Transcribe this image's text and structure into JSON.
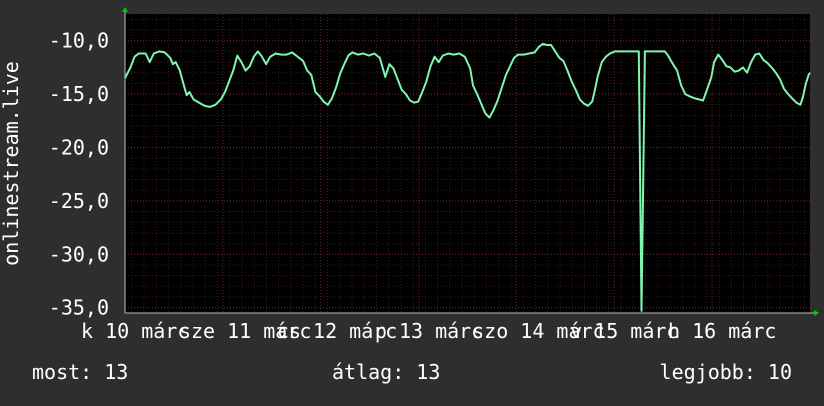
{
  "chart_data": {
    "type": "line",
    "ylabel": "onlinestream.live",
    "ylim": [
      -35.5,
      -7.5
    ],
    "yticks": [
      -10,
      -15,
      -20,
      -25,
      -30,
      -35
    ],
    "ytick_labels": [
      "-10,0",
      "-15,0",
      "-20,0",
      "-25,0",
      "-30,0",
      "-35,0"
    ],
    "xlim": [
      0,
      100
    ],
    "xtick_labels": [
      {
        "x": 0.0,
        "label": "k 10 márc"
      },
      {
        "x": 14.3,
        "label": "sze 11 márc"
      },
      {
        "x": 28.6,
        "label": "cs 12 márc"
      },
      {
        "x": 42.9,
        "label": "p 13 márc"
      },
      {
        "x": 57.1,
        "label": "szo 14 márc"
      },
      {
        "x": 71.4,
        "label": "v 15 márc"
      },
      {
        "x": 85.7,
        "label": "h 16 márc"
      }
    ],
    "grid": true,
    "colors": {
      "background": "#2e2e2e",
      "plot_background": "#000000",
      "line": "#7ff5b0",
      "grid": "#4a2222",
      "text": "#ffffff",
      "arrow": "#00cc00"
    },
    "series": [
      {
        "values": [
          [
            0.0,
            -13.5
          ],
          [
            0.8,
            -12.5
          ],
          [
            1.4,
            -11.5
          ],
          [
            2.0,
            -11.2
          ],
          [
            3.0,
            -11.2
          ],
          [
            3.6,
            -12.0
          ],
          [
            4.2,
            -11.2
          ],
          [
            5.0,
            -11.0
          ],
          [
            5.8,
            -11.1
          ],
          [
            6.6,
            -11.6
          ],
          [
            7.0,
            -12.2
          ],
          [
            7.4,
            -12.0
          ],
          [
            8.0,
            -12.8
          ],
          [
            8.6,
            -14.2
          ],
          [
            9.0,
            -15.1
          ],
          [
            9.4,
            -14.8
          ],
          [
            10.0,
            -15.5
          ],
          [
            10.8,
            -15.8
          ],
          [
            11.6,
            -16.1
          ],
          [
            12.4,
            -16.2
          ],
          [
            13.2,
            -16.0
          ],
          [
            14.0,
            -15.5
          ],
          [
            14.6,
            -14.8
          ],
          [
            15.2,
            -13.8
          ],
          [
            15.8,
            -12.8
          ],
          [
            16.4,
            -11.4
          ],
          [
            17.0,
            -12.0
          ],
          [
            17.6,
            -12.8
          ],
          [
            18.2,
            -12.4
          ],
          [
            18.8,
            -11.5
          ],
          [
            19.4,
            -11.0
          ],
          [
            20.0,
            -11.5
          ],
          [
            20.6,
            -12.2
          ],
          [
            21.2,
            -11.5
          ],
          [
            22.0,
            -11.2
          ],
          [
            22.8,
            -11.3
          ],
          [
            23.6,
            -11.3
          ],
          [
            24.4,
            -11.1
          ],
          [
            25.2,
            -11.5
          ],
          [
            26.0,
            -11.9
          ],
          [
            26.6,
            -12.8
          ],
          [
            27.2,
            -13.2
          ],
          [
            27.8,
            -14.8
          ],
          [
            28.4,
            -15.2
          ],
          [
            29.0,
            -15.7
          ],
          [
            29.6,
            -16.0
          ],
          [
            30.2,
            -15.4
          ],
          [
            30.8,
            -14.4
          ],
          [
            31.4,
            -13.1
          ],
          [
            32.0,
            -12.2
          ],
          [
            32.6,
            -11.4
          ],
          [
            33.2,
            -11.1
          ],
          [
            34.0,
            -11.3
          ],
          [
            34.8,
            -11.2
          ],
          [
            35.6,
            -11.4
          ],
          [
            36.4,
            -11.2
          ],
          [
            37.2,
            -11.6
          ],
          [
            38.0,
            -13.4
          ],
          [
            38.6,
            -12.2
          ],
          [
            39.2,
            -12.6
          ],
          [
            39.8,
            -13.6
          ],
          [
            40.4,
            -14.6
          ],
          [
            41.0,
            -15.0
          ],
          [
            41.6,
            -15.6
          ],
          [
            42.2,
            -15.8
          ],
          [
            42.8,
            -15.7
          ],
          [
            43.4,
            -14.8
          ],
          [
            44.0,
            -13.8
          ],
          [
            44.6,
            -12.4
          ],
          [
            45.2,
            -11.5
          ],
          [
            45.8,
            -12.0
          ],
          [
            46.4,
            -11.4
          ],
          [
            47.2,
            -11.2
          ],
          [
            48.0,
            -11.3
          ],
          [
            48.8,
            -11.2
          ],
          [
            49.6,
            -11.5
          ],
          [
            50.4,
            -12.6
          ],
          [
            50.8,
            -14.2
          ],
          [
            51.4,
            -15.0
          ],
          [
            52.0,
            -15.9
          ],
          [
            52.6,
            -16.8
          ],
          [
            53.2,
            -17.2
          ],
          [
            53.8,
            -16.5
          ],
          [
            54.4,
            -15.6
          ],
          [
            55.0,
            -14.4
          ],
          [
            55.6,
            -13.2
          ],
          [
            56.2,
            -12.4
          ],
          [
            56.8,
            -11.6
          ],
          [
            57.4,
            -11.3
          ],
          [
            58.2,
            -11.3
          ],
          [
            59.0,
            -11.2
          ],
          [
            59.8,
            -11.1
          ],
          [
            60.4,
            -10.6
          ],
          [
            61.0,
            -10.3
          ],
          [
            61.6,
            -10.4
          ],
          [
            62.2,
            -10.4
          ],
          [
            62.8,
            -11.0
          ],
          [
            63.4,
            -11.6
          ],
          [
            64.0,
            -11.9
          ],
          [
            64.6,
            -12.8
          ],
          [
            65.2,
            -13.8
          ],
          [
            65.8,
            -14.6
          ],
          [
            66.4,
            -15.5
          ],
          [
            67.0,
            -15.9
          ],
          [
            67.6,
            -16.1
          ],
          [
            68.2,
            -15.7
          ],
          [
            68.6,
            -14.6
          ],
          [
            69.0,
            -13.4
          ],
          [
            69.6,
            -12.0
          ],
          [
            70.2,
            -11.5
          ],
          [
            70.8,
            -11.2
          ],
          [
            71.5,
            -11.0
          ],
          [
            73.0,
            -11.0
          ],
          [
            74.4,
            -11.0
          ],
          [
            75.0,
            -11.0
          ],
          [
            75.4,
            -35.3
          ],
          [
            75.9,
            -11.0
          ],
          [
            77.0,
            -11.0
          ],
          [
            78.0,
            -11.0
          ],
          [
            78.8,
            -11.0
          ],
          [
            79.2,
            -11.3
          ],
          [
            80.0,
            -12.2
          ],
          [
            80.6,
            -12.8
          ],
          [
            81.2,
            -14.2
          ],
          [
            81.8,
            -15.0
          ],
          [
            82.4,
            -15.2
          ],
          [
            83.2,
            -15.4
          ],
          [
            83.8,
            -15.5
          ],
          [
            84.4,
            -15.6
          ],
          [
            85.0,
            -14.5
          ],
          [
            85.6,
            -13.4
          ],
          [
            86.0,
            -12.0
          ],
          [
            86.6,
            -11.3
          ],
          [
            87.2,
            -11.8
          ],
          [
            87.8,
            -12.4
          ],
          [
            88.4,
            -12.5
          ],
          [
            89.0,
            -12.9
          ],
          [
            89.6,
            -12.8
          ],
          [
            90.2,
            -12.5
          ],
          [
            90.8,
            -13.0
          ],
          [
            91.4,
            -12.0
          ],
          [
            92.0,
            -11.3
          ],
          [
            92.6,
            -11.2
          ],
          [
            93.2,
            -11.8
          ],
          [
            93.8,
            -12.1
          ],
          [
            94.4,
            -12.5
          ],
          [
            95.0,
            -13.0
          ],
          [
            95.6,
            -13.6
          ],
          [
            96.2,
            -14.5
          ],
          [
            96.8,
            -15.0
          ],
          [
            97.4,
            -15.4
          ],
          [
            98.0,
            -15.8
          ],
          [
            98.6,
            -16.0
          ],
          [
            99.0,
            -15.2
          ],
          [
            99.4,
            -14.0
          ],
          [
            99.8,
            -13.2
          ],
          [
            100.0,
            -13.0
          ]
        ]
      }
    ]
  },
  "stats": {
    "now": "most: 13",
    "avg": "átlag: 13",
    "max": "legjobb: 10"
  }
}
